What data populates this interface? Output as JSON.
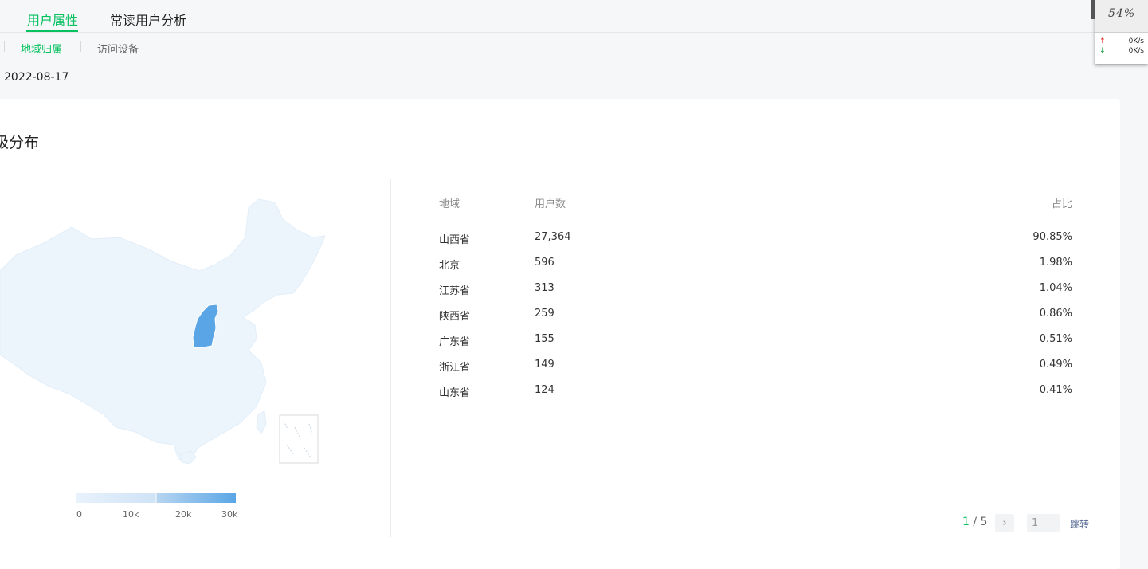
{
  "tabs": [
    {
      "label": "用户属性",
      "active": true
    },
    {
      "label": "常读用户分析",
      "active": false
    }
  ],
  "subtabs": [
    {
      "label": "地域归属",
      "active": true
    },
    {
      "label": "访问设备",
      "active": false
    }
  ],
  "date": "2022-08-17",
  "card": {
    "title": "级分布",
    "map": {
      "highlight_province": "山西省",
      "legend_ticks": [
        "0",
        "10k",
        "20k",
        "30k"
      ],
      "colors": {
        "base": "#ecf4fc",
        "highlight": "#59a5e6",
        "border": "#ffffff"
      }
    },
    "table": {
      "headers": {
        "region": "地域",
        "users": "用户数",
        "ratio": "占比"
      },
      "rows": [
        {
          "region": "山西省",
          "users": "27,364",
          "ratio": "90.85%"
        },
        {
          "region": "北京",
          "users": "596",
          "ratio": "1.98%"
        },
        {
          "region": "江苏省",
          "users": "313",
          "ratio": "1.04%"
        },
        {
          "region": "陕西省",
          "users": "259",
          "ratio": "0.86%"
        },
        {
          "region": "广东省",
          "users": "155",
          "ratio": "0.51%"
        },
        {
          "region": "浙江省",
          "users": "149",
          "ratio": "0.49%"
        },
        {
          "region": "山东省",
          "users": "124",
          "ratio": "0.41%"
        }
      ]
    },
    "pager": {
      "current": "1",
      "total": "/ 5",
      "input_value": "1",
      "jump_label": "跳转",
      "next_icon": "chevron-right-icon"
    }
  },
  "net_widget": {
    "percent": "54%",
    "upload": "0K/s",
    "download": "0K/s",
    "upload_color": "#e0322c",
    "download_color": "#1a9e3a"
  }
}
